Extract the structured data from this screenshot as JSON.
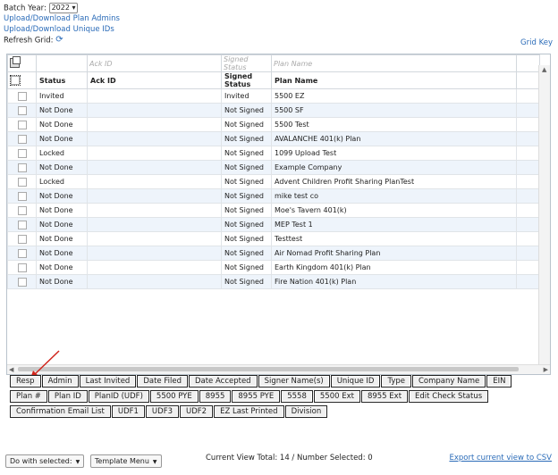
{
  "top": {
    "batch_year_label": "Batch Year:",
    "batch_year_value": "2022",
    "link_admins": "Upload/Download Plan Admins",
    "link_ids": "Upload/Download Unique IDs",
    "refresh_label": "Refresh Grid:",
    "grid_key": "Grid Key"
  },
  "grid": {
    "filters": [
      "Ack ID",
      "Signed Status",
      "Plan Name"
    ],
    "headers": [
      "Status",
      "Ack ID",
      "Signed Status",
      "Plan Name"
    ],
    "rows": [
      {
        "status": "Invited",
        "ack": "",
        "signed": "Invited",
        "plan": "5500 EZ"
      },
      {
        "status": "Not Done",
        "ack": "",
        "signed": "Not Signed",
        "plan": "5500 SF"
      },
      {
        "status": "Not Done",
        "ack": "",
        "signed": "Not Signed",
        "plan": "5500 Test"
      },
      {
        "status": "Not Done",
        "ack": "",
        "signed": "Not Signed",
        "plan": "AVALANCHE 401(k) Plan"
      },
      {
        "status": "Locked",
        "ack": "",
        "signed": "Not Signed",
        "plan": "1099 Upload Test"
      },
      {
        "status": "Not Done",
        "ack": "",
        "signed": "Not Signed",
        "plan": "Example Company"
      },
      {
        "status": "Locked",
        "ack": "",
        "signed": "Not Signed",
        "plan": "Advent Children Profit Sharing PlanTest"
      },
      {
        "status": "Not Done",
        "ack": "",
        "signed": "Not Signed",
        "plan": "mike test co"
      },
      {
        "status": "Not Done",
        "ack": "",
        "signed": "Not Signed",
        "plan": "Moe's Tavern 401(k)"
      },
      {
        "status": "Not Done",
        "ack": "",
        "signed": "Not Signed",
        "plan": "MEP Test 1"
      },
      {
        "status": "Not Done",
        "ack": "",
        "signed": "Not Signed",
        "plan": "Testtest"
      },
      {
        "status": "Not Done",
        "ack": "",
        "signed": "Not Signed",
        "plan": "Air Nomad Profit Sharing Plan"
      },
      {
        "status": "Not Done",
        "ack": "",
        "signed": "Not Signed",
        "plan": "Earth Kingdom 401(k) Plan"
      },
      {
        "status": "Not Done",
        "ack": "",
        "signed": "Not Signed",
        "plan": "Fire Nation 401(k) Plan"
      }
    ]
  },
  "chips": [
    [
      "Resp",
      "Admin",
      "Last Invited",
      "Date Filed",
      "Date Accepted",
      "Signer Name(s)",
      "Unique ID",
      "Type",
      "Company Name",
      "EIN"
    ],
    [
      "Plan #",
      "Plan ID",
      "PlanID (UDF)",
      "5500 PYE",
      "8955",
      "8955 PYE",
      "5558",
      "5500 Ext",
      "8955 Ext",
      "Edit Check Status"
    ],
    [
      "Confirmation Email List",
      "UDF1",
      "UDF3",
      "UDF2",
      "EZ Last Printed",
      "Division"
    ]
  ],
  "footer": {
    "do_with": "Do with selected:",
    "template": "Template Menu",
    "view_total": "Current View Total: 14 / Number Selected: 0",
    "export": "Export current view to CSV"
  },
  "colors": {
    "link": "#2a6bb8",
    "row_alt": "#eef4fb",
    "arrow": "#d0241b"
  },
  "icons": [
    "refresh-icon",
    "column-chooser-icon",
    "chevron-down-icon",
    "annotation-arrow"
  ]
}
